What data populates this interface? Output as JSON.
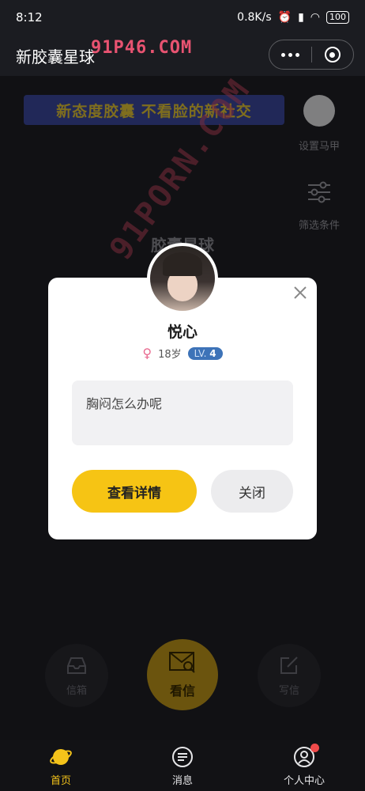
{
  "status": {
    "time": "8:12",
    "speed": "0.8K/s",
    "battery": "100"
  },
  "header": {
    "title": "新胶囊星球"
  },
  "watermarks": {
    "top": "91P46.COM",
    "diagonal": "91PORN.COM"
  },
  "banner": {
    "text": "新态度胶囊 不看脸的新社交"
  },
  "side_actions": {
    "mask_label": "设置马甲",
    "filter_label": "筛选条件"
  },
  "planet": {
    "label": "胶囊星球"
  },
  "actions": {
    "inbox": "信箱",
    "read": "看信",
    "write": "写信"
  },
  "modal": {
    "name": "悦心",
    "age": "18岁",
    "level_prefix": "LV.",
    "level": "4",
    "message": "胸闷怎么办呢",
    "detail_button": "查看详情",
    "close_button": "关闭"
  },
  "tabs": [
    {
      "label": "首页",
      "active": true
    },
    {
      "label": "消息",
      "active": false
    },
    {
      "label": "个人中心",
      "active": false
    }
  ],
  "colors": {
    "accent": "#f6c414",
    "level_badge": "#3d73b8",
    "banner_bg": "#3c4aa0"
  }
}
